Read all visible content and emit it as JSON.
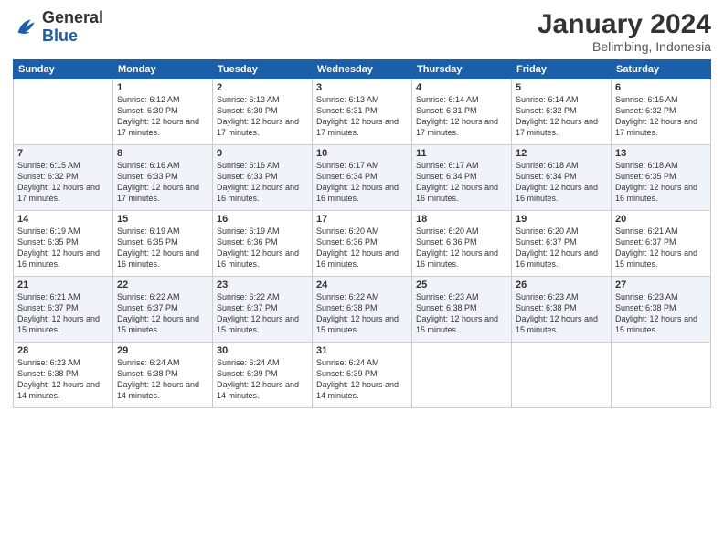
{
  "header": {
    "logo_general": "General",
    "logo_blue": "Blue",
    "title": "January 2024",
    "subtitle": "Belimbing, Indonesia"
  },
  "calendar": {
    "days_of_week": [
      "Sunday",
      "Monday",
      "Tuesday",
      "Wednesday",
      "Thursday",
      "Friday",
      "Saturday"
    ],
    "weeks": [
      [
        {
          "day": "",
          "sunrise": "",
          "sunset": "",
          "daylight": ""
        },
        {
          "day": "1",
          "sunrise": "Sunrise: 6:12 AM",
          "sunset": "Sunset: 6:30 PM",
          "daylight": "Daylight: 12 hours and 17 minutes."
        },
        {
          "day": "2",
          "sunrise": "Sunrise: 6:13 AM",
          "sunset": "Sunset: 6:30 PM",
          "daylight": "Daylight: 12 hours and 17 minutes."
        },
        {
          "day": "3",
          "sunrise": "Sunrise: 6:13 AM",
          "sunset": "Sunset: 6:31 PM",
          "daylight": "Daylight: 12 hours and 17 minutes."
        },
        {
          "day": "4",
          "sunrise": "Sunrise: 6:14 AM",
          "sunset": "Sunset: 6:31 PM",
          "daylight": "Daylight: 12 hours and 17 minutes."
        },
        {
          "day": "5",
          "sunrise": "Sunrise: 6:14 AM",
          "sunset": "Sunset: 6:32 PM",
          "daylight": "Daylight: 12 hours and 17 minutes."
        },
        {
          "day": "6",
          "sunrise": "Sunrise: 6:15 AM",
          "sunset": "Sunset: 6:32 PM",
          "daylight": "Daylight: 12 hours and 17 minutes."
        }
      ],
      [
        {
          "day": "7",
          "sunrise": "Sunrise: 6:15 AM",
          "sunset": "Sunset: 6:32 PM",
          "daylight": "Daylight: 12 hours and 17 minutes."
        },
        {
          "day": "8",
          "sunrise": "Sunrise: 6:16 AM",
          "sunset": "Sunset: 6:33 PM",
          "daylight": "Daylight: 12 hours and 17 minutes."
        },
        {
          "day": "9",
          "sunrise": "Sunrise: 6:16 AM",
          "sunset": "Sunset: 6:33 PM",
          "daylight": "Daylight: 12 hours and 16 minutes."
        },
        {
          "day": "10",
          "sunrise": "Sunrise: 6:17 AM",
          "sunset": "Sunset: 6:34 PM",
          "daylight": "Daylight: 12 hours and 16 minutes."
        },
        {
          "day": "11",
          "sunrise": "Sunrise: 6:17 AM",
          "sunset": "Sunset: 6:34 PM",
          "daylight": "Daylight: 12 hours and 16 minutes."
        },
        {
          "day": "12",
          "sunrise": "Sunrise: 6:18 AM",
          "sunset": "Sunset: 6:34 PM",
          "daylight": "Daylight: 12 hours and 16 minutes."
        },
        {
          "day": "13",
          "sunrise": "Sunrise: 6:18 AM",
          "sunset": "Sunset: 6:35 PM",
          "daylight": "Daylight: 12 hours and 16 minutes."
        }
      ],
      [
        {
          "day": "14",
          "sunrise": "Sunrise: 6:19 AM",
          "sunset": "Sunset: 6:35 PM",
          "daylight": "Daylight: 12 hours and 16 minutes."
        },
        {
          "day": "15",
          "sunrise": "Sunrise: 6:19 AM",
          "sunset": "Sunset: 6:35 PM",
          "daylight": "Daylight: 12 hours and 16 minutes."
        },
        {
          "day": "16",
          "sunrise": "Sunrise: 6:19 AM",
          "sunset": "Sunset: 6:36 PM",
          "daylight": "Daylight: 12 hours and 16 minutes."
        },
        {
          "day": "17",
          "sunrise": "Sunrise: 6:20 AM",
          "sunset": "Sunset: 6:36 PM",
          "daylight": "Daylight: 12 hours and 16 minutes."
        },
        {
          "day": "18",
          "sunrise": "Sunrise: 6:20 AM",
          "sunset": "Sunset: 6:36 PM",
          "daylight": "Daylight: 12 hours and 16 minutes."
        },
        {
          "day": "19",
          "sunrise": "Sunrise: 6:20 AM",
          "sunset": "Sunset: 6:37 PM",
          "daylight": "Daylight: 12 hours and 16 minutes."
        },
        {
          "day": "20",
          "sunrise": "Sunrise: 6:21 AM",
          "sunset": "Sunset: 6:37 PM",
          "daylight": "Daylight: 12 hours and 15 minutes."
        }
      ],
      [
        {
          "day": "21",
          "sunrise": "Sunrise: 6:21 AM",
          "sunset": "Sunset: 6:37 PM",
          "daylight": "Daylight: 12 hours and 15 minutes."
        },
        {
          "day": "22",
          "sunrise": "Sunrise: 6:22 AM",
          "sunset": "Sunset: 6:37 PM",
          "daylight": "Daylight: 12 hours and 15 minutes."
        },
        {
          "day": "23",
          "sunrise": "Sunrise: 6:22 AM",
          "sunset": "Sunset: 6:37 PM",
          "daylight": "Daylight: 12 hours and 15 minutes."
        },
        {
          "day": "24",
          "sunrise": "Sunrise: 6:22 AM",
          "sunset": "Sunset: 6:38 PM",
          "daylight": "Daylight: 12 hours and 15 minutes."
        },
        {
          "day": "25",
          "sunrise": "Sunrise: 6:23 AM",
          "sunset": "Sunset: 6:38 PM",
          "daylight": "Daylight: 12 hours and 15 minutes."
        },
        {
          "day": "26",
          "sunrise": "Sunrise: 6:23 AM",
          "sunset": "Sunset: 6:38 PM",
          "daylight": "Daylight: 12 hours and 15 minutes."
        },
        {
          "day": "27",
          "sunrise": "Sunrise: 6:23 AM",
          "sunset": "Sunset: 6:38 PM",
          "daylight": "Daylight: 12 hours and 15 minutes."
        }
      ],
      [
        {
          "day": "28",
          "sunrise": "Sunrise: 6:23 AM",
          "sunset": "Sunset: 6:38 PM",
          "daylight": "Daylight: 12 hours and 14 minutes."
        },
        {
          "day": "29",
          "sunrise": "Sunrise: 6:24 AM",
          "sunset": "Sunset: 6:38 PM",
          "daylight": "Daylight: 12 hours and 14 minutes."
        },
        {
          "day": "30",
          "sunrise": "Sunrise: 6:24 AM",
          "sunset": "Sunset: 6:39 PM",
          "daylight": "Daylight: 12 hours and 14 minutes."
        },
        {
          "day": "31",
          "sunrise": "Sunrise: 6:24 AM",
          "sunset": "Sunset: 6:39 PM",
          "daylight": "Daylight: 12 hours and 14 minutes."
        },
        {
          "day": "",
          "sunrise": "",
          "sunset": "",
          "daylight": ""
        },
        {
          "day": "",
          "sunrise": "",
          "sunset": "",
          "daylight": ""
        },
        {
          "day": "",
          "sunrise": "",
          "sunset": "",
          "daylight": ""
        }
      ]
    ]
  }
}
